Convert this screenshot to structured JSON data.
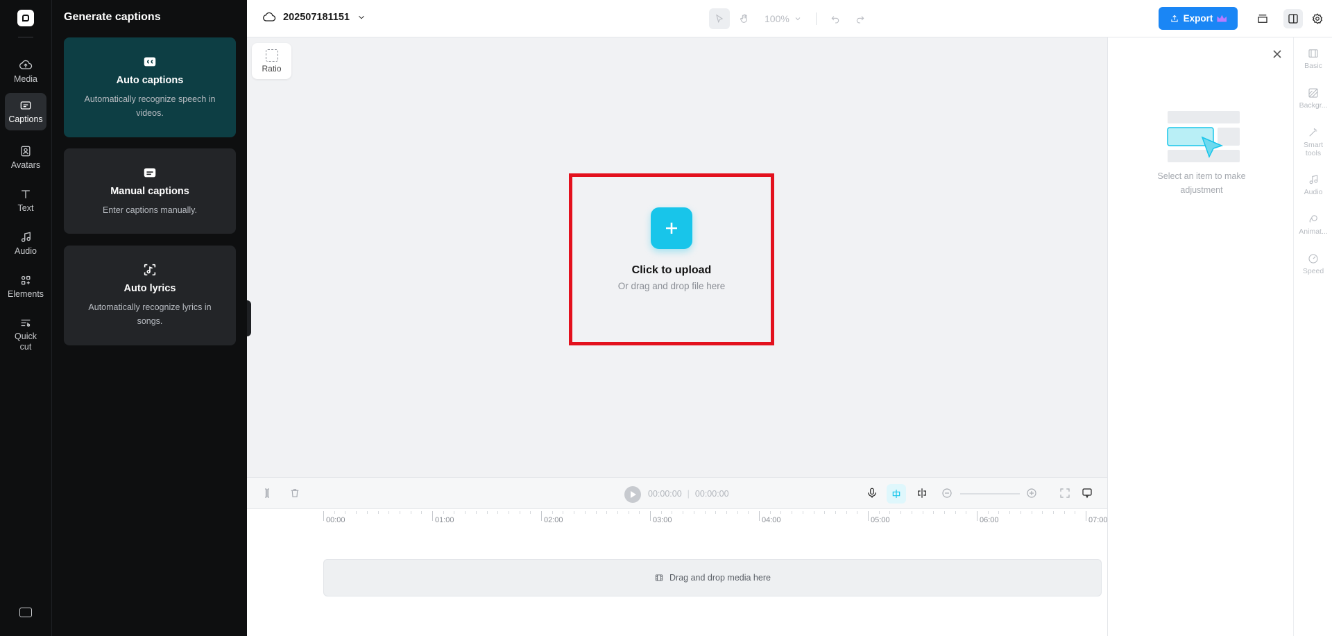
{
  "rail": {
    "items": [
      {
        "label": "Media",
        "icon": "cloud-upload-icon"
      },
      {
        "label": "Captions",
        "icon": "captions-icon",
        "active": true
      },
      {
        "label": "Avatars",
        "icon": "avatar-icon"
      },
      {
        "label": "Text",
        "icon": "text-icon"
      },
      {
        "label": "Audio",
        "icon": "music-note-icon"
      },
      {
        "label": "Elements",
        "icon": "elements-icon"
      },
      {
        "label": "Quick cut",
        "icon": "quick-cut-icon"
      }
    ]
  },
  "panel": {
    "title": "Generate captions",
    "cards": [
      {
        "title": "Auto captions",
        "desc": "Automatically recognize speech in videos.",
        "icon": "cc-icon"
      },
      {
        "title": "Manual captions",
        "desc": "Enter captions manually.",
        "icon": "subtitle-icon"
      },
      {
        "title": "Auto lyrics",
        "desc": "Automatically recognize lyrics in songs.",
        "icon": "lyrics-icon"
      }
    ]
  },
  "topbar": {
    "project_name": "202507181151",
    "zoom": "100%",
    "export_label": "Export"
  },
  "canvas": {
    "ratio_label": "Ratio",
    "upload_title": "Click to upload",
    "upload_sub": "Or drag and drop file here"
  },
  "timeline": {
    "current_time": "00:00:00",
    "total_time": "00:00:00",
    "ruler": [
      "00:00",
      "01:00",
      "02:00",
      "03:00",
      "04:00",
      "05:00",
      "06:00",
      "07:00"
    ],
    "drop_label": "Drag and drop media here"
  },
  "props": {
    "empty_message": "Select an item to make adjustment",
    "tabs": [
      "Basic",
      "Backgr...",
      "Smart tools",
      "Audio",
      "Animat...",
      "Speed"
    ]
  },
  "colors": {
    "accent": "#18c5ea",
    "export": "#1a86f5",
    "highlight": "#e3111d"
  }
}
